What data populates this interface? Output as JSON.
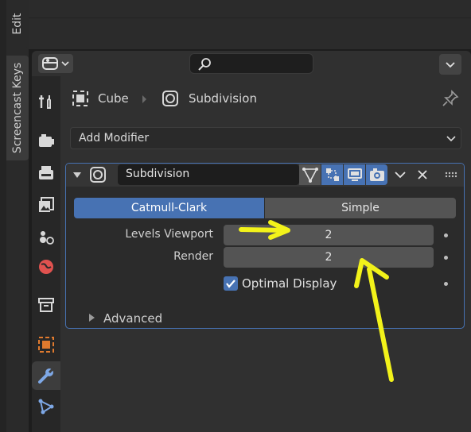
{
  "side_tabs": [
    "Edit",
    "Screencast Keys"
  ],
  "breadcrumb": {
    "object": "Cube",
    "modifier": "Subdivision"
  },
  "add_modifier_label": "Add Modifier",
  "modifier": {
    "name": "Subdivision",
    "mode_options": [
      "Catmull-Clark",
      "Simple"
    ],
    "selected_mode": "Catmull-Clark",
    "levels_viewport_label": "Levels Viewport",
    "levels_viewport_value": "2",
    "render_label": "Render",
    "render_value": "2",
    "optimal_display_label": "Optimal Display",
    "optimal_display_checked": true,
    "advanced_label": "Advanced"
  },
  "colors": {
    "accent": "#4772b3",
    "annotation_arrows": "#f2f21a",
    "active_tab_icon_wrench": "#7ea8e6",
    "object_tab_icon": "#e07a2e",
    "physics_icon": "#e0524f"
  },
  "icons": [
    "editor-type-icon",
    "search-icon",
    "chevron-down-icon",
    "tool-icon",
    "render-icon",
    "output-icon",
    "view-layer-icon",
    "scene-icon",
    "world-icon",
    "collection-icon",
    "object-icon",
    "modifier-wrench-icon",
    "particles-icon",
    "pin-icon",
    "edit-mode-icon",
    "realtime-icon",
    "render-toggle-icon",
    "close-icon",
    "drag-handle-icon"
  ]
}
